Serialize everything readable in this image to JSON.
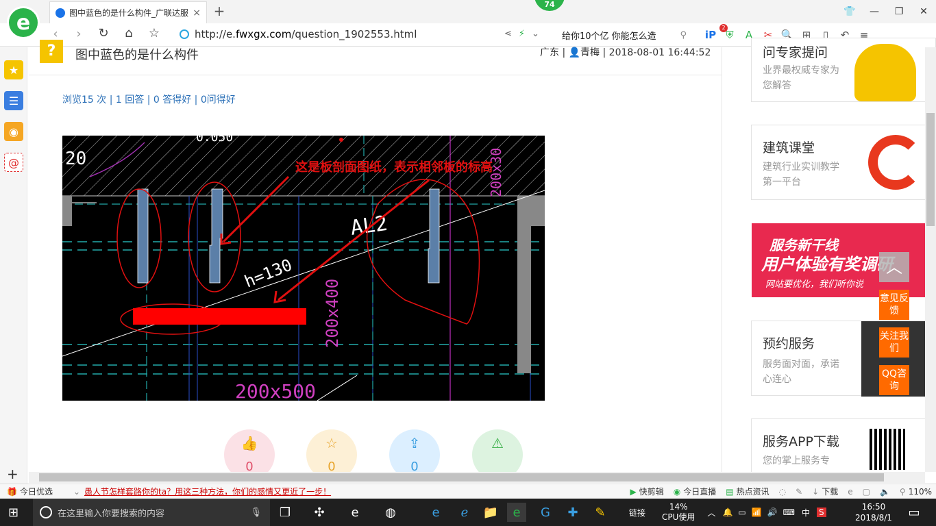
{
  "browser": {
    "tab_title": "图中蓝色的是什么构件_广联达服",
    "tab_close": "×",
    "new_tab": "+",
    "badge_count": "74",
    "url_prefix": "http://e.",
    "url_domain": "fwxgx.com",
    "url_path": "/question_1902553.html",
    "search_text": "给你10个亿 你能怎么造",
    "tools_badge": "2"
  },
  "question": {
    "title": "图中蓝色的是什么构件",
    "meta": "广东 | 👤青梅 | 2018-08-01 16:44:52",
    "stats": "浏览15 次 | 1 回答 | 0 答得好 | 0问得好"
  },
  "drawing": {
    "annotation": "这是板剖面图纸，表示相邻板的标高",
    "label_al2": "AL2",
    "label_h": "h=130",
    "label_200x400": "200x400",
    "label_200x500": "200x500",
    "label_200x30": "200x30",
    "label_20": "20",
    "label_top": "0.050"
  },
  "actions": [
    {
      "icon": "👍",
      "count": "0",
      "color": "#e0516b",
      "bg": "#fbe1e6"
    },
    {
      "icon": "☆",
      "count": "0",
      "color": "#e8a42a",
      "bg": "#fdf0d6"
    },
    {
      "icon": "⇪",
      "count": "0",
      "color": "#3a9ee0",
      "bg": "#dcefff"
    },
    {
      "icon": "⚠",
      "count": "",
      "color": "#3bb04a",
      "bg": "#ddf3e0"
    }
  ],
  "right": {
    "expert_title": "问专家提问",
    "expert_sub": "业界最权威专家为您解答",
    "course_title": "建筑课堂",
    "course_sub": "建筑行业实训教学第一平台",
    "banner_line1": "服务新干线",
    "banner_line2": "用户体验有奖调研",
    "banner_line3": "网站要优化，我们听你说",
    "booking_title": "预约服务",
    "booking_sub": "服务面对面，承诺心连心",
    "app_title": "服务APP下载",
    "app_sub": "您的掌上服务专"
  },
  "float_buttons": {
    "back_top": "︿",
    "feedback": "意见反馈",
    "follow": "关注我们",
    "qq": "QQ咨询"
  },
  "statusbar": {
    "daily": "今日优选",
    "news": "愚人节怎样套路你的ta？用这三种方法，你们的感情又更近了一步！",
    "clip": "快剪辑",
    "live": "今日直播",
    "hot": "热点资讯",
    "download": "下载",
    "zoom": "110%"
  },
  "taskbar": {
    "search_placeholder": "在这里输入你要搜索的内容",
    "link": "链接",
    "cpu": "14%",
    "cpu_label": "CPU使用",
    "ime": "中",
    "time": "16:50",
    "date": "2018/8/1"
  }
}
